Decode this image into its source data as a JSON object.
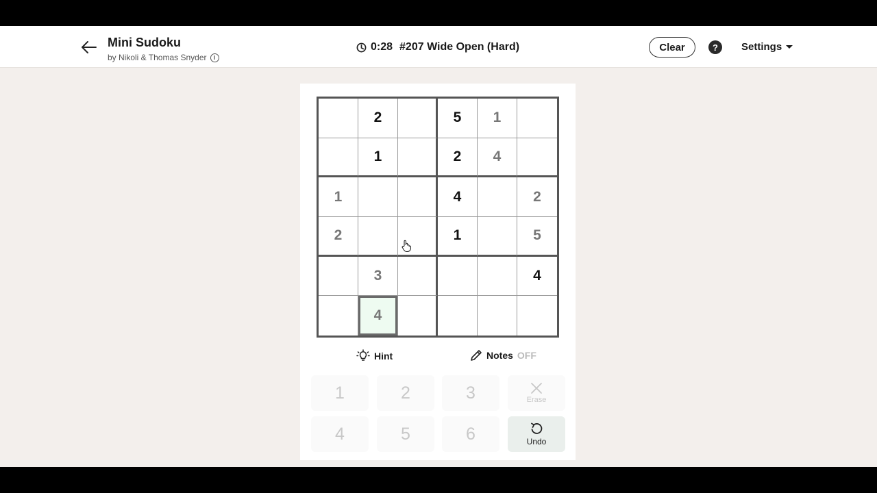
{
  "header": {
    "title": "Mini Sudoku",
    "subtitle": "by Nikoli & Thomas Snyder",
    "timer": "0:28",
    "puzzle": "#207 Wide Open (Hard)",
    "clear_label": "Clear",
    "help_label": "?",
    "settings_label": "Settings"
  },
  "board": {
    "rows": [
      [
        {
          "v": "",
          "t": "empty"
        },
        {
          "v": "2",
          "t": "given"
        },
        {
          "v": "",
          "t": "empty"
        },
        {
          "v": "5",
          "t": "given"
        },
        {
          "v": "1",
          "t": "user"
        },
        {
          "v": "",
          "t": "empty"
        }
      ],
      [
        {
          "v": "",
          "t": "empty"
        },
        {
          "v": "1",
          "t": "given"
        },
        {
          "v": "",
          "t": "empty"
        },
        {
          "v": "2",
          "t": "given"
        },
        {
          "v": "4",
          "t": "user"
        },
        {
          "v": "",
          "t": "empty"
        }
      ],
      [
        {
          "v": "1",
          "t": "user"
        },
        {
          "v": "",
          "t": "empty"
        },
        {
          "v": "",
          "t": "empty"
        },
        {
          "v": "4",
          "t": "given"
        },
        {
          "v": "",
          "t": "empty"
        },
        {
          "v": "2",
          "t": "user"
        }
      ],
      [
        {
          "v": "2",
          "t": "user"
        },
        {
          "v": "",
          "t": "empty"
        },
        {
          "v": "",
          "t": "empty"
        },
        {
          "v": "1",
          "t": "given"
        },
        {
          "v": "",
          "t": "empty"
        },
        {
          "v": "5",
          "t": "user"
        }
      ],
      [
        {
          "v": "",
          "t": "empty"
        },
        {
          "v": "3",
          "t": "user"
        },
        {
          "v": "",
          "t": "empty"
        },
        {
          "v": "",
          "t": "empty"
        },
        {
          "v": "",
          "t": "empty"
        },
        {
          "v": "4",
          "t": "given"
        }
      ],
      [
        {
          "v": "",
          "t": "empty"
        },
        {
          "v": "4",
          "t": "user"
        },
        {
          "v": "",
          "t": "empty"
        },
        {
          "v": "",
          "t": "empty"
        },
        {
          "v": "",
          "t": "empty"
        },
        {
          "v": "",
          "t": "empty"
        }
      ]
    ],
    "selected": [
      5,
      1
    ]
  },
  "tools": {
    "hint_label": "Hint",
    "notes_label": "Notes",
    "notes_state": "OFF"
  },
  "keypad": {
    "keys": [
      "1",
      "2",
      "3",
      "4",
      "5",
      "6"
    ],
    "erase_label": "Erase",
    "undo_label": "Undo"
  }
}
